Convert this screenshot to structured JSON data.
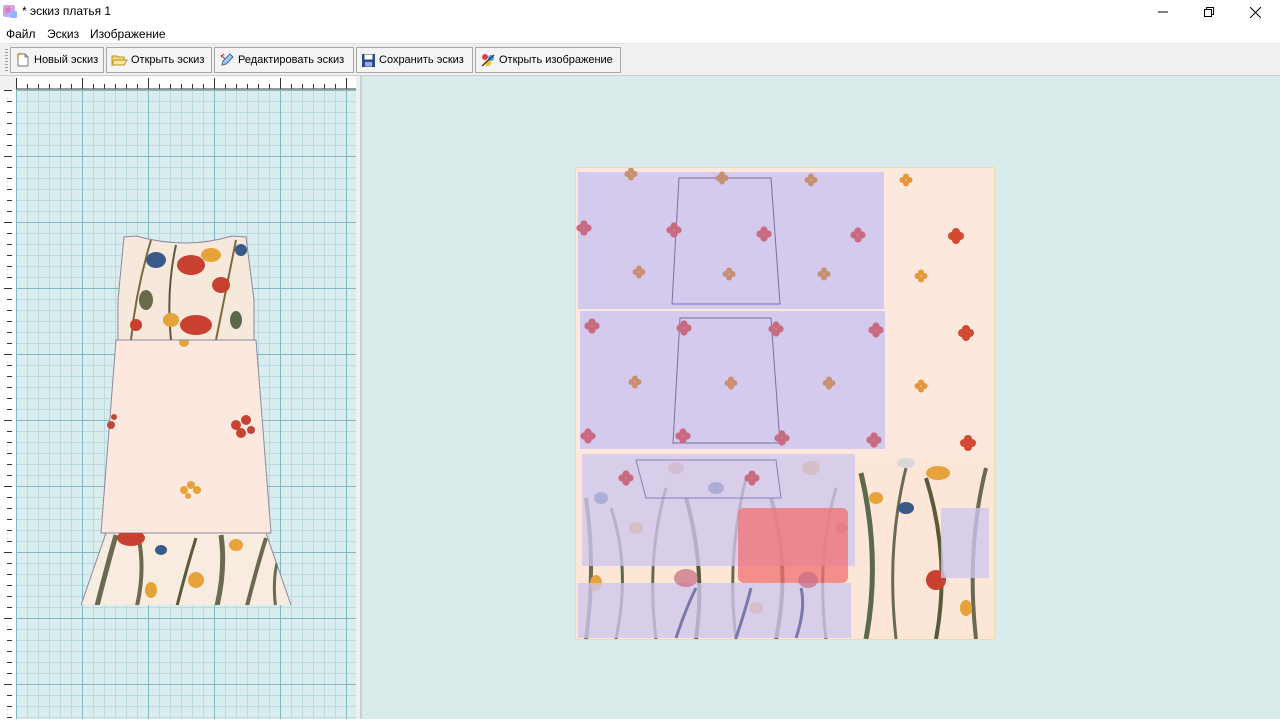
{
  "window": {
    "title": "* эскиз платья 1",
    "icon": "app-sketch-icon"
  },
  "menu": {
    "items": [
      "Файл",
      "Эскиз",
      "Изображение"
    ]
  },
  "toolbar": {
    "new_label": "Новый эскиз",
    "open_label": "Открыть эскиз",
    "edit_label": "Редактировать эскиз",
    "save_label": "Сохранить эскиз",
    "open_image_label": "Открыть изображение"
  },
  "colors": {
    "grid_bg": "#d9ecee",
    "grid_major": "#7fb8c0",
    "grid_minor": "#b9dbe0",
    "workspace_bg": "#d9ebeb",
    "pattern_piece": "#cfc7ee",
    "bodice_highlight": "#f07070"
  }
}
